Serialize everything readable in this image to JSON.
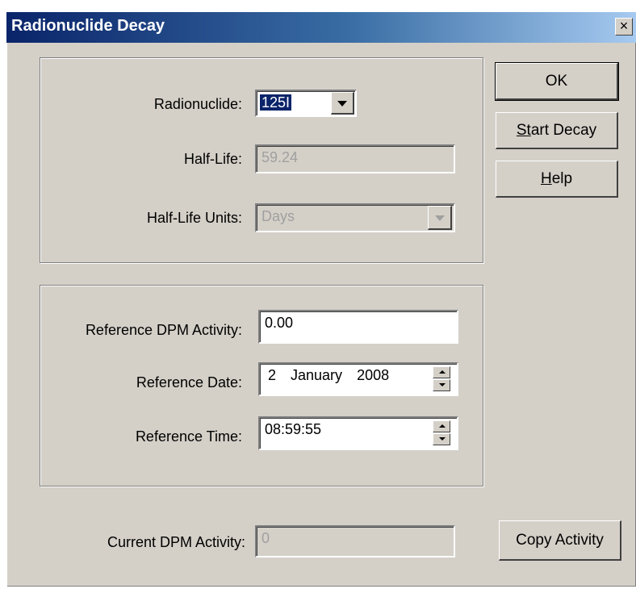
{
  "window": {
    "title": "Radionuclide Decay"
  },
  "nuclide_group": {
    "radionuclide_label": "Radionuclide:",
    "radionuclide_value": "125I",
    "half_life_label": "Half-Life:",
    "half_life_value": "59.24",
    "half_life_units_label": "Half-Life Units:",
    "half_life_units_value": "Days"
  },
  "reference_group": {
    "activity_label": "Reference DPM Activity:",
    "activity_value": "0.00",
    "date_label": "Reference Date:",
    "date_day": "2",
    "date_month": "January",
    "date_year": "2008",
    "time_label": "Reference Time:",
    "time_value": "08:59:55"
  },
  "current": {
    "label": "Current DPM Activity:",
    "value": "0"
  },
  "buttons": {
    "ok": "OK",
    "start_decay_first": "S",
    "start_decay_u": "t",
    "start_decay_rest": "art Decay",
    "help_u": "H",
    "help_rest": "elp",
    "copy_activity": "Copy Activity",
    "close": "×"
  }
}
